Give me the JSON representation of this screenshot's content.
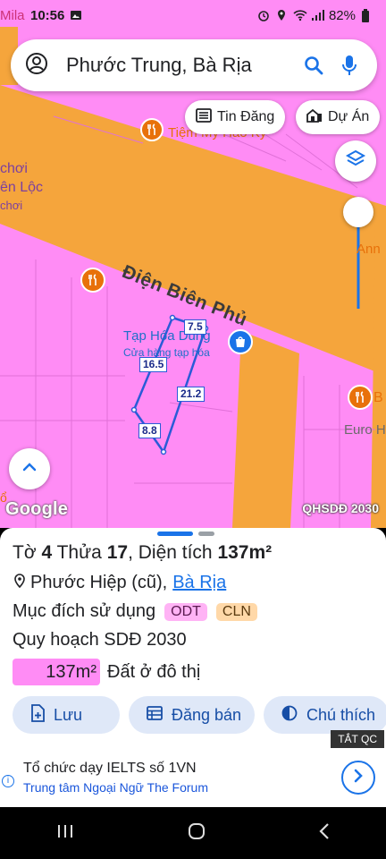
{
  "status_bar": {
    "carrier_fragment": "Mila",
    "time": "10:56",
    "battery": "82%"
  },
  "search": {
    "query": "Phước Trung, Bà Rịa"
  },
  "chips": {
    "listings": "Tin Đăng",
    "projects": "Dự Án"
  },
  "map": {
    "road_name": "Điện Biên Phủ",
    "poi_restaurant": "Tiệm Mỳ Hảo Ký",
    "poi_shop_name": "Tạp Hóa Dung",
    "poi_shop_type": "Cửa hàng tạp hóa",
    "poi_euro": "Euro H",
    "poi_right_letter": "B",
    "poi_right_top": "Ann",
    "left_label_1": "chơi",
    "left_label_2": "ên Lộc",
    "left_label_3": "chơi",
    "left_label_4": "ổ",
    "dimensions": {
      "top": "7.5",
      "left": "16.5",
      "right": "21.2",
      "bottom": "8.8"
    },
    "google_logo": "Google",
    "map_tag": "QHSDĐ 2030",
    "colors": {
      "residential": "#ff8cf5",
      "road": "#f5a53c",
      "poi_orange": "#e8710a",
      "parcel_outline": "#2a5bd7"
    }
  },
  "sheet": {
    "title_prefix_1": "Tờ",
    "sheet_number": "4",
    "title_prefix_2": "Thửa",
    "parcel_number": "17",
    "title_prefix_3": ", Diện tích",
    "area": "137m²",
    "location_text": "Phước Hiệp (cũ),",
    "location_link": "Bà Rịa",
    "purpose_label": "Mục đích sử dụng",
    "purpose_codes": [
      "ODT",
      "CLN"
    ],
    "plan_label": "Quy hoạch SDĐ 2030",
    "plan_area": "137m²",
    "plan_type": "Đất ở đô thị",
    "actions": {
      "save": "Lưu",
      "post_sale": "Đăng bán",
      "legend": "Chú thích"
    }
  },
  "ad": {
    "close_label": "TẮT QC",
    "line1": "Tổ chức dạy IELTS số 1VN",
    "line2": "Trung tâm Ngoại Ngữ The Forum"
  }
}
